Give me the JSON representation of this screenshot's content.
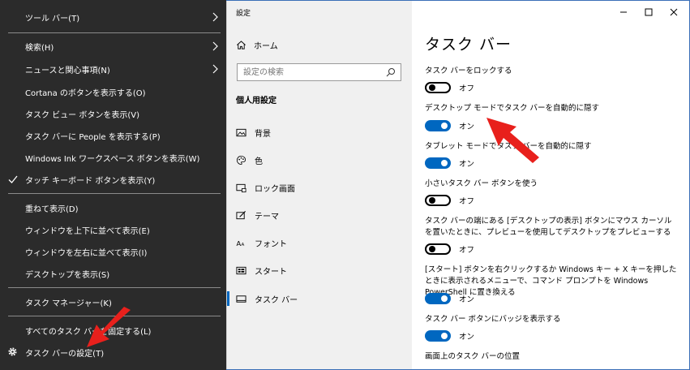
{
  "context_menu": {
    "items": [
      {
        "label": "ツール バー(T)",
        "submenu": true
      },
      {
        "label": "検索(H)",
        "submenu": true
      },
      {
        "label": "ニュースと関心事項(N)",
        "submenu": true
      },
      {
        "label": "Cortana のボタンを表示する(O)"
      },
      {
        "label": "タスク ビュー ボタンを表示(V)"
      },
      {
        "label": "タスク バーに People を表示する(P)"
      },
      {
        "label": "Windows Ink ワークスペース ボタンを表示(W)"
      },
      {
        "label": "タッチ キーボード ボタンを表示(Y)",
        "checked": true
      },
      {
        "label": "重ねて表示(D)"
      },
      {
        "label": "ウィンドウを上下に並べて表示(E)"
      },
      {
        "label": "ウィンドウを左右に並べて表示(I)"
      },
      {
        "label": "デスクトップを表示(S)"
      },
      {
        "label": "タスク マネージャー(K)"
      },
      {
        "label": "すべてのタスク バーを固定する(L)"
      },
      {
        "label": "タスク バーの設定(T)",
        "icon": "gear-icon"
      }
    ]
  },
  "settings": {
    "window_title": "設定",
    "nav": {
      "home_label": "ホーム",
      "search_placeholder": "設定の検索",
      "section_title": "個人用設定",
      "items": [
        {
          "label": "背景",
          "icon": "picture-icon"
        },
        {
          "label": "色",
          "icon": "palette-icon"
        },
        {
          "label": "ロック画面",
          "icon": "lock-screen-icon"
        },
        {
          "label": "テーマ",
          "icon": "theme-icon"
        },
        {
          "label": "フォント",
          "icon": "font-icon"
        },
        {
          "label": "スタート",
          "icon": "start-icon"
        },
        {
          "label": "タスク バー",
          "icon": "taskbar-icon",
          "active": true
        }
      ]
    },
    "page_title": "タスク バー",
    "options": [
      {
        "label": "タスク バーをロックする",
        "state": false,
        "state_label": "オフ"
      },
      {
        "label": "デスクトップ モードでタスク バーを自動的に隠す",
        "state": true,
        "state_label": "オン"
      },
      {
        "label": "タブレット モードでタスク バーを自動的に隠す",
        "state": true,
        "state_label": "オン"
      },
      {
        "label": "小さいタスク バー ボタンを使う",
        "state": false,
        "state_label": "オフ"
      },
      {
        "label": "タスク バーの端にある [デスクトップの表示] ボタンにマウス カーソルを置いたときに、プレビューを使用してデスクトップをプレビューする",
        "state": false,
        "state_label": "オフ"
      },
      {
        "label": "[スタート] ボタンを右クリックするか Windows キー + X キーを押したときに表示されるメニューで、コマンド プロンプトを Windows PowerShell に置き換える",
        "state": true,
        "state_label": "オン"
      },
      {
        "label": "タスク バー ボタンにバッジを表示する",
        "state": true,
        "state_label": "オン"
      }
    ],
    "next_section_label": "画面上のタスク バーの位置"
  },
  "colors": {
    "menu_bg": "#2b2b2b",
    "accent": "#0067c0",
    "annotation_arrow": "#e8201c"
  }
}
